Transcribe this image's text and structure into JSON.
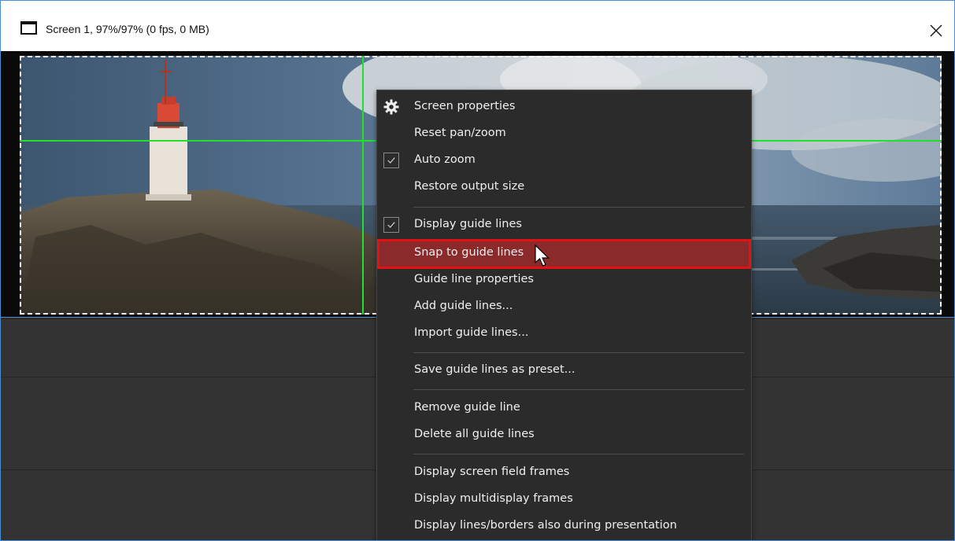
{
  "window": {
    "title": "Screen 1, 97%/97% (0 fps, 0 MB)",
    "close_label": "✕",
    "accent": "#4a8fd6"
  },
  "guide_color": "#22e12c",
  "context_menu": {
    "items": [
      {
        "label": "Screen properties",
        "icon": "gear-icon"
      },
      {
        "label": "Reset pan/zoom"
      },
      {
        "label": "Auto zoom",
        "checked": true
      },
      {
        "label": "Restore output size"
      },
      {
        "label": "Display guide lines",
        "checked": true
      },
      {
        "label": "Snap to guide lines",
        "highlighted": true
      },
      {
        "label": "Guide line properties"
      },
      {
        "label": "Add guide lines..."
      },
      {
        "label": "Import guide lines..."
      },
      {
        "label": "Save guide lines as preset..."
      },
      {
        "label": "Remove guide line"
      },
      {
        "label": "Delete all guide lines"
      },
      {
        "label": "Display screen field frames"
      },
      {
        "label": "Display multidisplay frames"
      },
      {
        "label": "Display lines/borders also during presentation"
      }
    ],
    "highlight_color": "#8b2a2a",
    "highlight_border": "#e21212"
  }
}
